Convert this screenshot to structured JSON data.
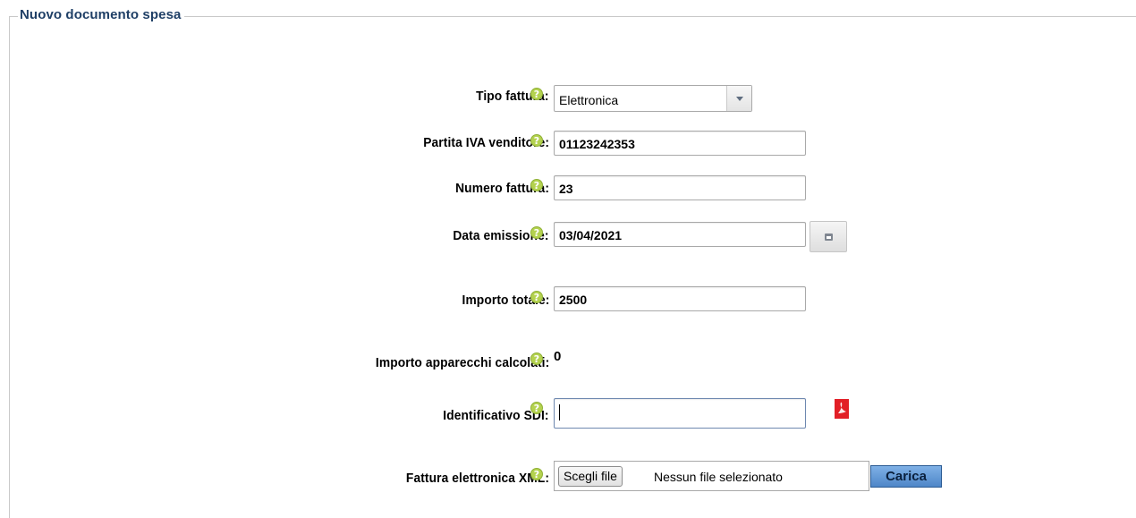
{
  "form": {
    "title": "Nuovo documento spesa",
    "help_glyph": "?",
    "fields": {
      "tipo_fattura": {
        "label": "Tipo fattura:",
        "value": "Elettronica"
      },
      "partita_iva": {
        "label": "Partita IVA venditore:",
        "value": "01123242353"
      },
      "numero_fattura": {
        "label": "Numero fattura:",
        "value": "23"
      },
      "data_emissione": {
        "label": "Data emissione:",
        "value": "03/04/2021"
      },
      "importo_totale": {
        "label": "Importo totale:",
        "value": "2500"
      },
      "importo_apparecchi": {
        "label": "Importo apparecchi calcolati:",
        "value": "0"
      },
      "identificativo_sdi": {
        "label": "Identificativo SDI:",
        "value": ""
      },
      "fattura_xml": {
        "label": "Fattura elettronica XML:",
        "choose_label": "Scegli file",
        "no_file_text": "Nessun file selezionato",
        "upload_label": "Carica"
      }
    },
    "icons": {
      "help": "help-icon",
      "dropdown": "chevron-down-icon",
      "calendar": "calendar-icon",
      "pdf": "pdf-icon"
    },
    "colors": {
      "title": "#1f3f66",
      "help_icon": "#b4d24f",
      "upload_button": "#4e86c8",
      "pdf_icon": "#e21f26"
    }
  }
}
